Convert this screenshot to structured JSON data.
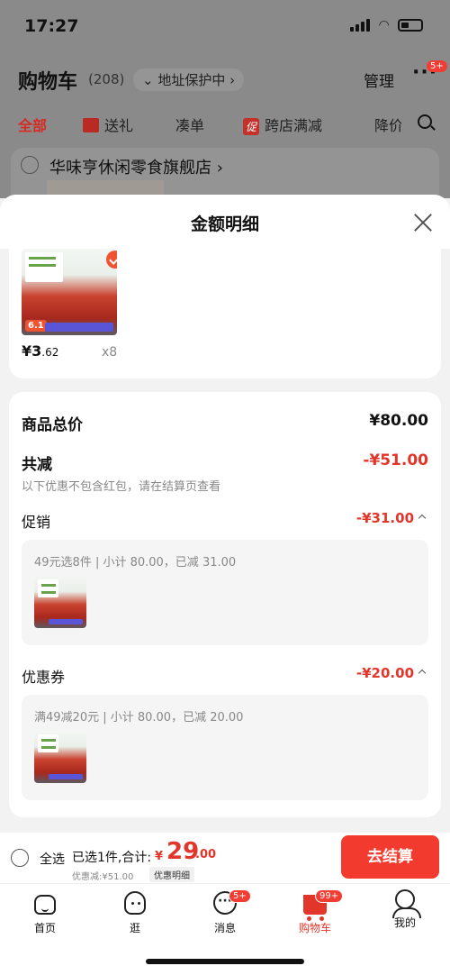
{
  "status_bar": {
    "time": "17:27"
  },
  "header": {
    "title": "购物车",
    "count": "(208)",
    "address_label": "地址保护中",
    "manage_label": "管理",
    "more_badge": "5+"
  },
  "filter_tabs": [
    {
      "label": "全部",
      "active": true
    },
    {
      "label": "送礼"
    },
    {
      "label": "凑单"
    },
    {
      "label": "跨店满减",
      "tag": "促"
    },
    {
      "label": "降价"
    }
  ],
  "store": {
    "name": "华味亨休闲零食旗舰店"
  },
  "sheet": {
    "title": "金额明细",
    "item": {
      "price_int": "¥3",
      "price_dec": ".62",
      "qty": "x8",
      "tag": "6.1"
    },
    "total_label": "商品总价",
    "total_value": "¥80.00",
    "reduce_label": "共减",
    "reduce_value": "-¥51.00",
    "note": "以下优惠不包含红包，请在结算页查看",
    "promo": {
      "label": "促销",
      "value": "-¥31.00",
      "detail": "49元选8件 | 小计 80.00，已减 31.00"
    },
    "coupon": {
      "label": "优惠券",
      "value": "-¥20.00",
      "detail": "满49减20元 | 小计 80.00，已减 20.00"
    }
  },
  "bottom_bar": {
    "select_all": "全选",
    "selected_text": "已选1件,合计:",
    "currency": "¥",
    "total_int": "29",
    "total_dec": ".00",
    "discount": "优惠减:¥51.00",
    "detail_link": "优惠明细",
    "checkout": "去结算"
  },
  "tab_bar": [
    {
      "label": "首页",
      "icon": "home-icon"
    },
    {
      "label": "逛",
      "icon": "guang-icon"
    },
    {
      "label": "消息",
      "icon": "message-icon",
      "badge": "5+"
    },
    {
      "label": "购物车",
      "icon": "cart-icon",
      "badge": "99+",
      "active": true
    },
    {
      "label": "我的",
      "icon": "profile-icon"
    }
  ],
  "colors": {
    "accent": "#e2362b",
    "checkout": "#f33a2e",
    "overlay": "#8a8a8a"
  }
}
